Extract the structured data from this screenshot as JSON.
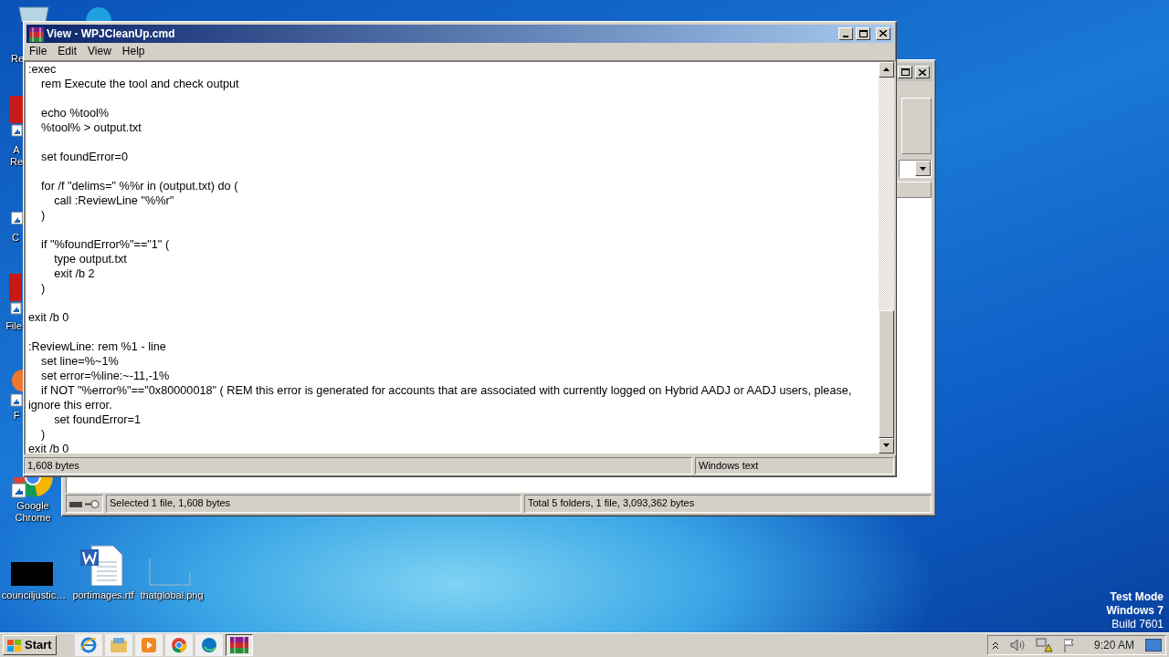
{
  "desktop": {
    "icons": [
      {
        "kind": "bin",
        "label": "Re"
      },
      {
        "kind": "blue-app"
      },
      {
        "kind": "red-app",
        "label": "A Re"
      },
      {
        "kind": "shortcut",
        "label": "C"
      },
      {
        "kind": "red-app",
        "label": "File"
      },
      {
        "kind": "orange-app",
        "label": "F"
      },
      {
        "kind": "chrome",
        "label": "Google Chrome"
      },
      {
        "kind": "black-thumb",
        "label": "counciljustic…"
      },
      {
        "kind": "word",
        "label": "portimages.rtf"
      },
      {
        "kind": "image",
        "label": "thatglobal.png"
      }
    ]
  },
  "back_window": {
    "status_bar": [
      "Selected 1 file, 1,608 bytes",
      "Total 5 folders, 1 file, 3,093,362 bytes"
    ]
  },
  "viewer": {
    "title": "View - WPJCleanUp.cmd",
    "menu": [
      "File",
      "Edit",
      "View",
      "Help"
    ],
    "lines": [
      {
        "kind": "code",
        "text": ":exec"
      },
      {
        "kind": "code",
        "text": "    rem Execute the tool and check output"
      },
      {
        "kind": "blank"
      },
      {
        "kind": "code",
        "text": "    echo %tool%"
      },
      {
        "kind": "code",
        "text": "    %tool% > output.txt"
      },
      {
        "kind": "blank"
      },
      {
        "kind": "code",
        "text": "    set foundError=0"
      },
      {
        "kind": "blank"
      },
      {
        "kind": "code",
        "text": "    for /f \"delims=\" %%r in (output.txt) do ("
      },
      {
        "kind": "code",
        "text": "        call :ReviewLine \"%%r\""
      },
      {
        "kind": "code",
        "text": "    )"
      },
      {
        "kind": "blank"
      },
      {
        "kind": "code",
        "text": "    if \"%foundError%\"==\"1\" ("
      },
      {
        "kind": "code",
        "text": "        type output.txt"
      },
      {
        "kind": "code",
        "text": "        exit /b 2"
      },
      {
        "kind": "code",
        "text": "    )"
      },
      {
        "kind": "blank"
      },
      {
        "kind": "code",
        "text": "exit /b 0"
      },
      {
        "kind": "blank"
      },
      {
        "kind": "code",
        "text": ":ReviewLine: rem %1 - line"
      },
      {
        "kind": "code",
        "text": "    set line=%~1%"
      },
      {
        "kind": "code",
        "text": "    set error=%line:~-11,-1%"
      },
      {
        "kind": "code",
        "text": "    if NOT \"%error%\"==\"0x80000018\" ( REM this error is generated for accounts that are associated with currently logged on Hybrid AADJ or AADJ users, please, ignore this error."
      },
      {
        "kind": "code",
        "text": "        set foundError=1"
      },
      {
        "kind": "code",
        "text": "    )"
      },
      {
        "kind": "code",
        "text": "exit /b 0"
      }
    ],
    "status_bar": [
      "1,608 bytes",
      "Windows text"
    ]
  },
  "system_notice": [
    "Test Mode",
    "Windows 7",
    "Build 7601"
  ],
  "taskbar": {
    "start": "Start",
    "apps": [
      {
        "kind": "ie",
        "active": false
      },
      {
        "kind": "explorer",
        "active": false
      },
      {
        "kind": "media",
        "active": false
      },
      {
        "kind": "chrome",
        "active": false
      },
      {
        "kind": "edge",
        "active": false
      },
      {
        "kind": "winrar",
        "active": true
      }
    ],
    "clock": "9:20 AM"
  }
}
